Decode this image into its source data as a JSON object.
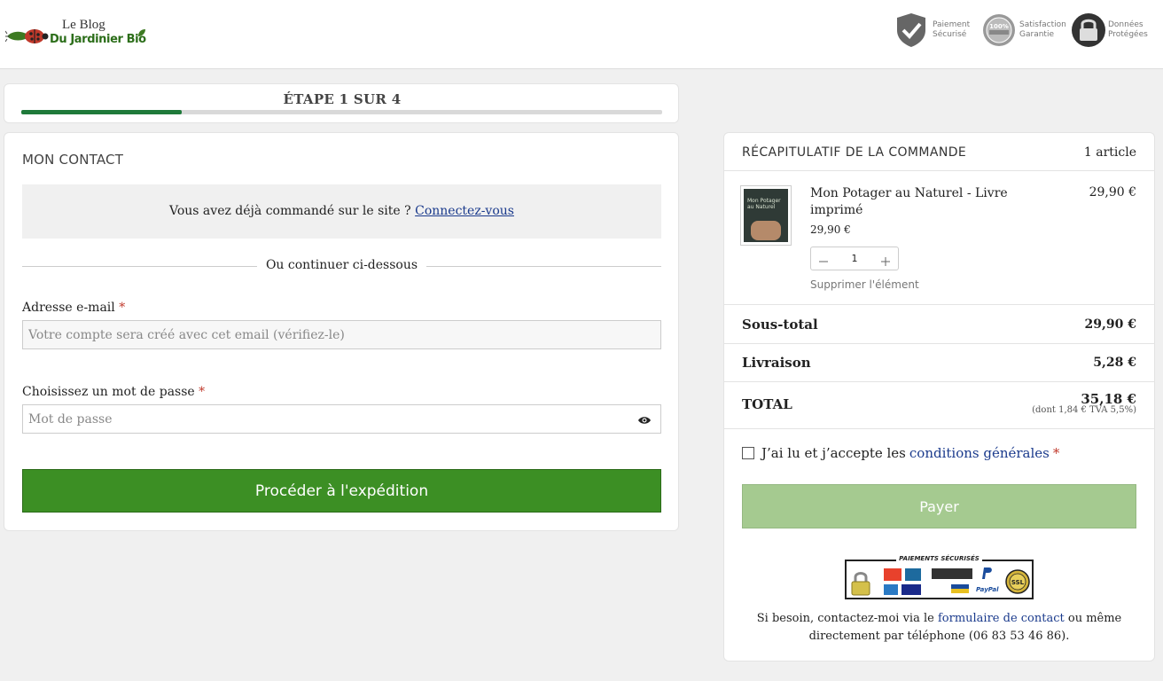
{
  "header": {
    "logo": {
      "line1": "Le Blog",
      "line2": "Du Jardinier Bio"
    },
    "trust_badges": [
      {
        "label": "Paiement\nSécurisé",
        "icon": "shield-check-icon"
      },
      {
        "label": "Satisfaction\nGarantie",
        "icon": "satisfaction-seal-icon"
      },
      {
        "label": "Données\nProtégées",
        "icon": "padlock-icon"
      }
    ]
  },
  "progress": {
    "label": "ÉTAPE 1 SUR 4",
    "fraction": 0.25,
    "color": "#1f7a3a"
  },
  "contact": {
    "title": "MON CONTACT",
    "login_prompt": "Vous avez déjà commandé sur le site ?",
    "login_link": "Connectez-vous",
    "divider": "Ou continuer ci-dessous",
    "email_label": "Adresse e-mail",
    "email_placeholder": "Votre compte sera créé avec cet email (vérifiez-le)",
    "password_label": "Choisissez un mot de passe",
    "password_placeholder": "Mot de passe",
    "required_mark": "*",
    "proceed_button": "Procéder à l'expédition"
  },
  "order": {
    "title": "RÉCAPITULATIF DE LA COMMANDE",
    "count": "1 article",
    "item": {
      "name": "Mon Potager au Naturel - Livre imprimé",
      "line_price": "29,90 €",
      "unit_price": "29,90 €",
      "quantity": "1",
      "remove": "Supprimer l'élément",
      "thumb_text": "Mon Potager au Naturel"
    },
    "subtotal_label": "Sous-total",
    "subtotal": "29,90 €",
    "shipping_label": "Livraison",
    "shipping": "5,28 €",
    "total_label": "TOTAL",
    "total": "35,18 €",
    "tax_note": "(dont 1,84 € TVA 5,5%)",
    "terms_before": "J’ai lu et j’accepte les",
    "terms_link": "conditions générales",
    "terms_required": "*",
    "pay_button": "Payer",
    "secure_payments": "PAIEMENTS SÉCURISÉS",
    "payment_logos": [
      "Mastercard",
      "CB",
      "stripe",
      "PayPal",
      "SSL",
      "American Express",
      "VISA",
      "Apple Pay",
      "SEPA"
    ],
    "help_before": "Si besoin, contactez-moi via le",
    "help_link": "formulaire de contact",
    "help_after": "ou même directement par téléphone (06 83 53 46 86)."
  },
  "colors": {
    "brand_green": "#3c8f24",
    "pay_disabled": "#a5ca90",
    "link_blue": "#1a3a8c",
    "required_red": "#c0392b"
  }
}
